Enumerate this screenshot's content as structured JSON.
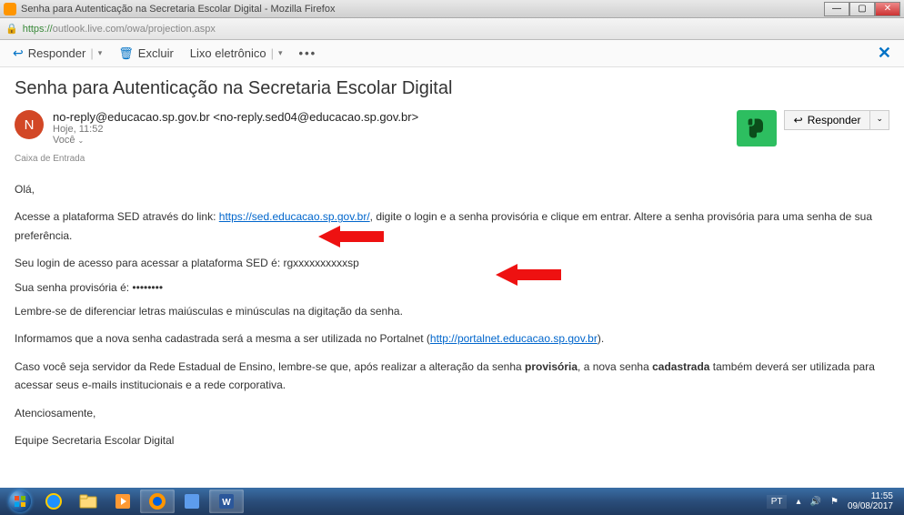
{
  "window": {
    "title": "Senha para Autenticação na Secretaria Escolar Digital - Mozilla Firefox",
    "url_secure": "https://",
    "url_host": "outlook.live.com",
    "url_path": "/owa/projection.aspx"
  },
  "toolbar": {
    "reply": "Responder",
    "delete": "Excluir",
    "junk": "Lixo eletrônico"
  },
  "email": {
    "subject": "Senha para Autenticação na Secretaria Escolar Digital",
    "avatar_initial": "N",
    "from_display": "no-reply@educacao.sp.gov.br <no-reply.sed04@educacao.sp.gov.br>",
    "time": "Hoje, 11:52",
    "to_label": "Você",
    "folder": "Caixa de Entrada",
    "reply_btn": "Responder"
  },
  "body": {
    "greeting": "Olá,",
    "p1_a": "Acesse a plataforma SED através do link: ",
    "p1_link": "https://sed.educacao.sp.gov.br/",
    "p1_b": ", digite o login e a senha provisória e clique em entrar. Altere a senha provisória para uma senha de sua preferência.",
    "login_prefix": "Seu login de acesso para acessar a plataforma SED é: ",
    "login_value": "rgxxxxxxxxxxsp",
    "senha_prefix": "Sua senha provisória é: ",
    "senha_value": "••••••••",
    "lembre": "Lembre-se de diferenciar letras maiúsculas e minúsculas na digitação da senha.",
    "p2_a": "Informamos que a nova senha cadastrada será a mesma a ser utilizada no Portalnet (",
    "p2_link": "http://portalnet.educacao.sp.gov.br",
    "p2_b": ").",
    "p3_a": "Caso você seja servidor da Rede Estadual de Ensino, lembre-se que, após realizar a alteração da senha ",
    "p3_bold1": "provisória",
    "p3_mid": ", a nova senha ",
    "p3_bold2": "cadastrada",
    "p3_b": " também deverá ser utilizada para acessar seus e-mails institucionais e a rede corporativa.",
    "signoff": "Atenciosamente,",
    "team": "Equipe Secretaria Escolar Digital"
  },
  "taskbar": {
    "lang": "PT",
    "time": "11:55",
    "date": "09/08/2017"
  }
}
